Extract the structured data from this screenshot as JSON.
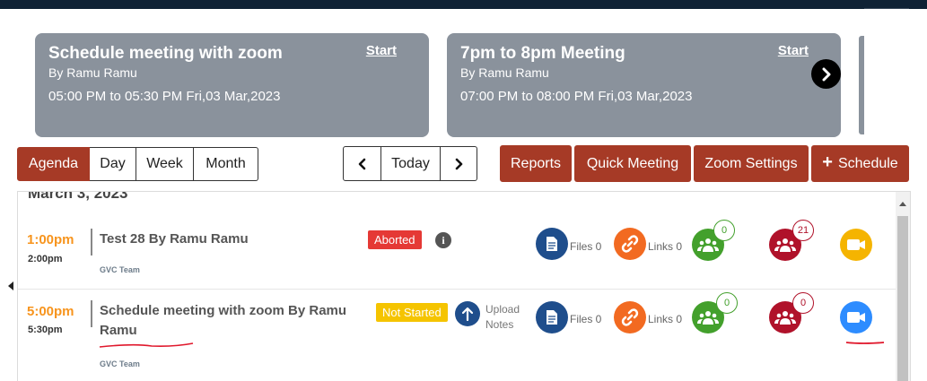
{
  "cards": [
    {
      "title": "Schedule meeting with zoom",
      "by": "By Ramu Ramu",
      "time": "05:00 PM to 05:30 PM Fri,03 Mar,2023",
      "start": "Start"
    },
    {
      "title": "7pm to 8pm Meeting",
      "by": "By Ramu Ramu",
      "time": "07:00 PM to 08:00 PM Fri,03 Mar,2023",
      "start": "Start"
    }
  ],
  "view_tabs": [
    "Agenda",
    "Day",
    "Week",
    "Month"
  ],
  "nav": {
    "today": "Today"
  },
  "actions": {
    "reports": "Reports",
    "quick_meeting": "Quick Meeting",
    "zoom_settings": "Zoom Settings",
    "schedule": "Schedule"
  },
  "date_header": "March 3, 2023",
  "meetings": [
    {
      "start": "1:00pm",
      "end": "2:00pm",
      "title": "Test 28 By Ramu Ramu",
      "team": "GVC Team",
      "status": "Aborted",
      "status_color": "#e53935",
      "files": "Files 0",
      "links": "Links 0",
      "accepted": "0",
      "declined": "21",
      "camera_color": "#f5b400"
    },
    {
      "start": "5:00pm",
      "end": "5:30pm",
      "title_line1": "Schedule meeting with zoom By Ramu",
      "title_line2": "Ramu",
      "team": "GVC Team",
      "status": "Not Started",
      "status_color": "#f5c400",
      "upload_line1": "Upload",
      "upload_line2": "Notes",
      "files": "Files 0",
      "links": "Links 0",
      "accepted": "0",
      "declined": "0",
      "camera_color": "#2d8cff"
    }
  ],
  "colors": {
    "accent": "#a63a26",
    "files": "#1f4e8c",
    "links": "#f26a21",
    "accepted": "#43a02c",
    "declined": "#b0122a",
    "time": "#f7941d"
  }
}
